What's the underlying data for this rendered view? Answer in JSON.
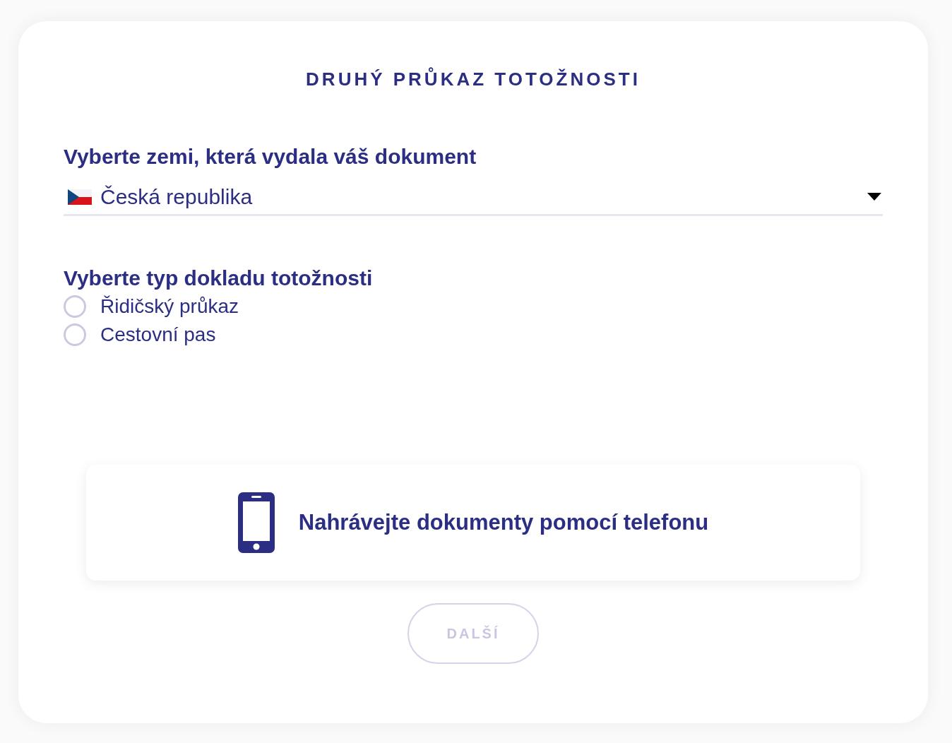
{
  "title": "DRUHÝ PRŮKAZ TOTOŽNOSTI",
  "country_label": "Vyberte zemi, která vydala váš dokument",
  "country_select": {
    "value": "Česká republika"
  },
  "doc_type_label": "Vyberte typ dokladu totožnosti",
  "doc_types": [
    {
      "label": "Řidičský průkaz",
      "selected": false
    },
    {
      "label": "Cestovní pas",
      "selected": false
    }
  ],
  "phone_upload": {
    "label": "Nahrávejte dokumenty pomocí telefonu"
  },
  "next_button": {
    "label": "DALŠÍ",
    "disabled": true
  }
}
